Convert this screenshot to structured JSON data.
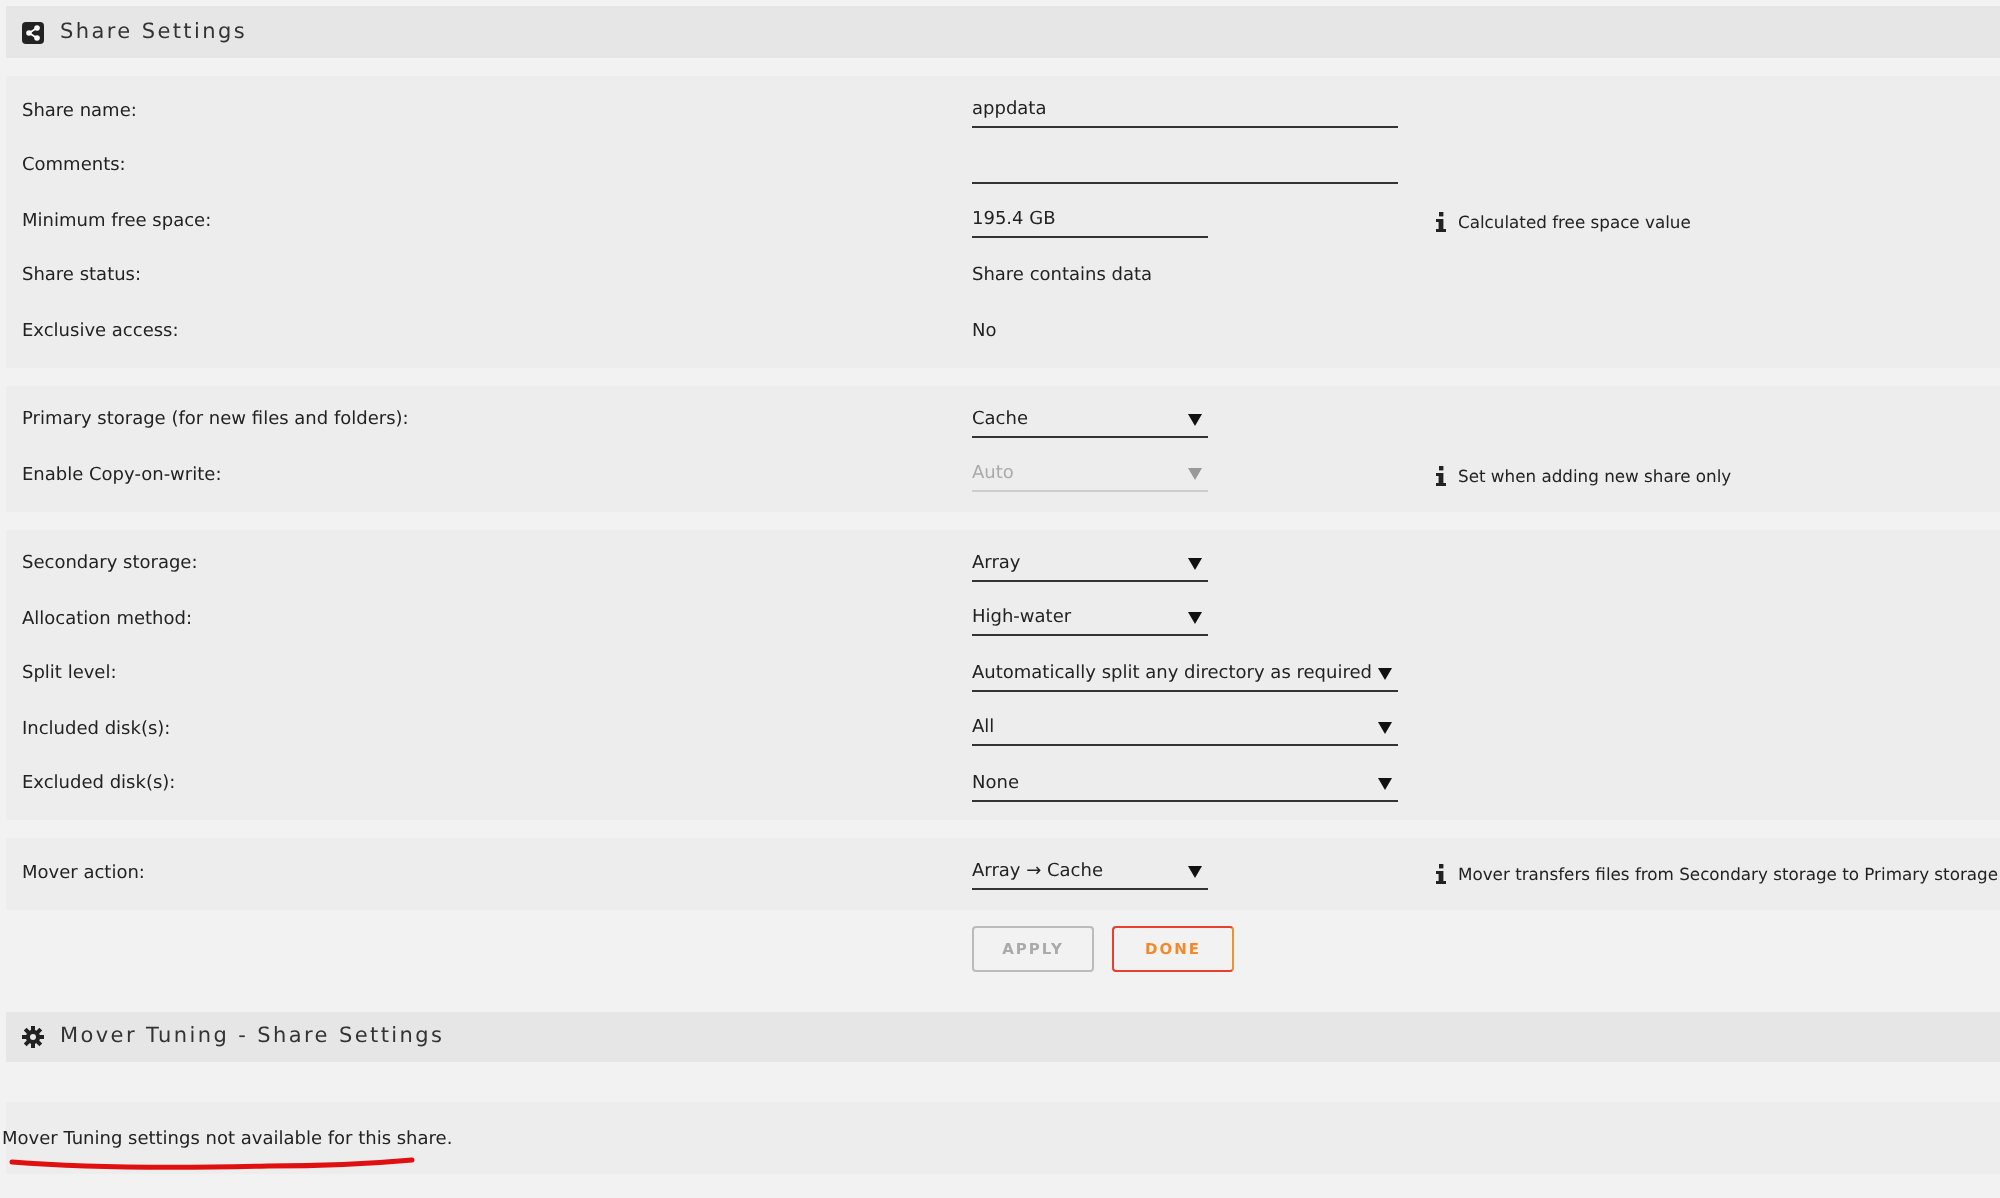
{
  "header": {
    "title": "Share Settings"
  },
  "sections": [
    {
      "rows": [
        {
          "label": "Share name:",
          "kind": "input",
          "value": "appdata",
          "wide": true
        },
        {
          "label": "Comments:",
          "kind": "input",
          "wide": true
        },
        {
          "label": "Minimum free space:",
          "kind": "input",
          "value": "195.4 GB",
          "wide": false,
          "hint": "Calculated free space value"
        },
        {
          "label": "Share status:",
          "kind": "text",
          "value": "Share contains data"
        },
        {
          "label": "Exclusive access:",
          "kind": "text",
          "value": "No"
        }
      ]
    },
    {
      "rows": [
        {
          "label": "Primary storage (for new files and folders):",
          "kind": "select",
          "value": "Cache",
          "wide": false,
          "disabled": false
        },
        {
          "label": "Enable Copy-on-write:",
          "kind": "select",
          "value": "Auto",
          "wide": false,
          "disabled": true,
          "hint": "Set when adding new share only"
        }
      ]
    },
    {
      "rows": [
        {
          "label": "Secondary storage:",
          "kind": "select",
          "value": "Array",
          "wide": false,
          "disabled": false
        },
        {
          "label": "Allocation method:",
          "kind": "select",
          "value": "High-water",
          "wide": false,
          "disabled": false
        },
        {
          "label": "Split level:",
          "kind": "select",
          "value": "Automatically split any directory as required",
          "wide": true,
          "disabled": false
        },
        {
          "label": "Included disk(s):",
          "kind": "select",
          "value": "All",
          "wide": true,
          "disabled": false
        },
        {
          "label": "Excluded disk(s):",
          "kind": "select",
          "value": "None",
          "wide": true,
          "disabled": false
        }
      ]
    },
    {
      "rows": [
        {
          "label": "Mover action:",
          "kind": "select",
          "value": "Array → Cache",
          "wide": false,
          "disabled": false,
          "hint": "Mover transfers files from Secondary storage to Primary storage"
        }
      ]
    }
  ],
  "buttons": [
    {
      "label": "APPLY",
      "disabled": true
    },
    {
      "label": "DONE",
      "disabled": false
    }
  ],
  "mover_header": {
    "title": "Mover Tuning - Share Settings"
  },
  "mover_note": "Mover Tuning settings not available for this share."
}
